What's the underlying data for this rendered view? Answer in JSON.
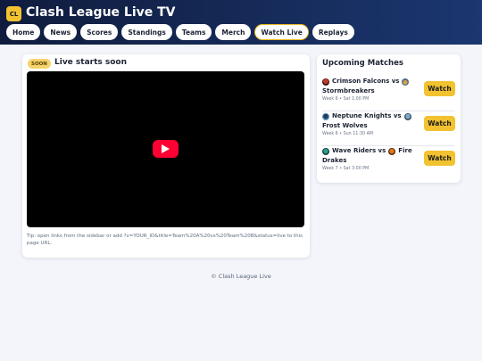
{
  "header": {
    "logo_text": "CL",
    "title": "Clash League Live TV",
    "nav": [
      "Home",
      "News",
      "Scores",
      "Standings",
      "Teams",
      "Merch",
      "Watch Live",
      "Replays"
    ],
    "active_nav": "Watch Live"
  },
  "stream": {
    "badge": "SOON",
    "title": "Live starts soon",
    "tip": "Tip: open links from the sidebar or add ?v=YOUR_ID&title=Team%20A%20vs%20Team%20B&status=live to this page URL."
  },
  "upcoming": {
    "title": "Upcoming Matches",
    "matches": [
      {
        "line1": "Crimson Falcons vs",
        "line2": "Stormbreakers",
        "meta": "Week 6 • Sat 1:00 PM",
        "icon1": "crimson-falcons-icon",
        "icon2": "stormbreakers-icon",
        "button": "Watch"
      },
      {
        "line1": "Neptune Knights vs",
        "line2": "Frost Wolves",
        "meta": "Week 6 • Sun 11:30 AM",
        "icon1": "neptune-knights-icon",
        "icon2": "frost-wolves-icon",
        "button": "Watch"
      },
      {
        "line1": "Wave Riders vs",
        "line2": "Fire",
        "line3": "Drakes",
        "meta": "Week 7 • Sat 3:00 PM",
        "icon1": "wave-riders-icon",
        "icon2": "fire-drakes-icon",
        "button": "Watch"
      }
    ]
  },
  "footer": {
    "text": "© Clash League Live"
  },
  "colors": {
    "header_start": "#0f1c3d",
    "header_end": "#1b3770",
    "accent": "#f2c230",
    "play": "#ff0033"
  }
}
